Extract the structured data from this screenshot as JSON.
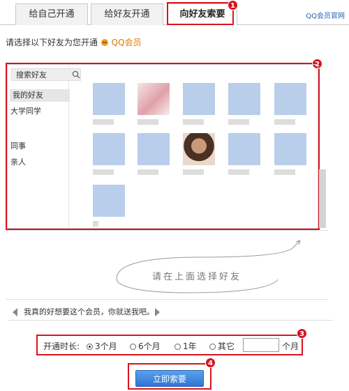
{
  "tabs": [
    {
      "label": "给自己开通"
    },
    {
      "label": "给好友开通"
    },
    {
      "label": "向好友索要"
    }
  ],
  "vip_link": "QQ会员官网",
  "prompt": {
    "text": "请选择以下好友为您开通",
    "vip_label": "QQ会员"
  },
  "badges": [
    "1",
    "2",
    "3",
    "4"
  ],
  "sidebar": {
    "search_label": "搜索好友",
    "groups": [
      "我的好友",
      "大学同学",
      "同事",
      "亲人"
    ]
  },
  "hint": "请在上面选择好友",
  "message": "我真的好想要这个会员，你就送我吧。",
  "duration": {
    "label": "开通时长:",
    "options": [
      "3个月",
      "6个月",
      "1年",
      "其它"
    ],
    "selected": "3个月",
    "custom_value": "",
    "unit": "个月"
  },
  "submit_label": "立即索要",
  "colors": {
    "highlight": "#d8141c",
    "vip": "#e07a00",
    "button": "#2f74d0",
    "avatar_default": "#b8ceea"
  }
}
